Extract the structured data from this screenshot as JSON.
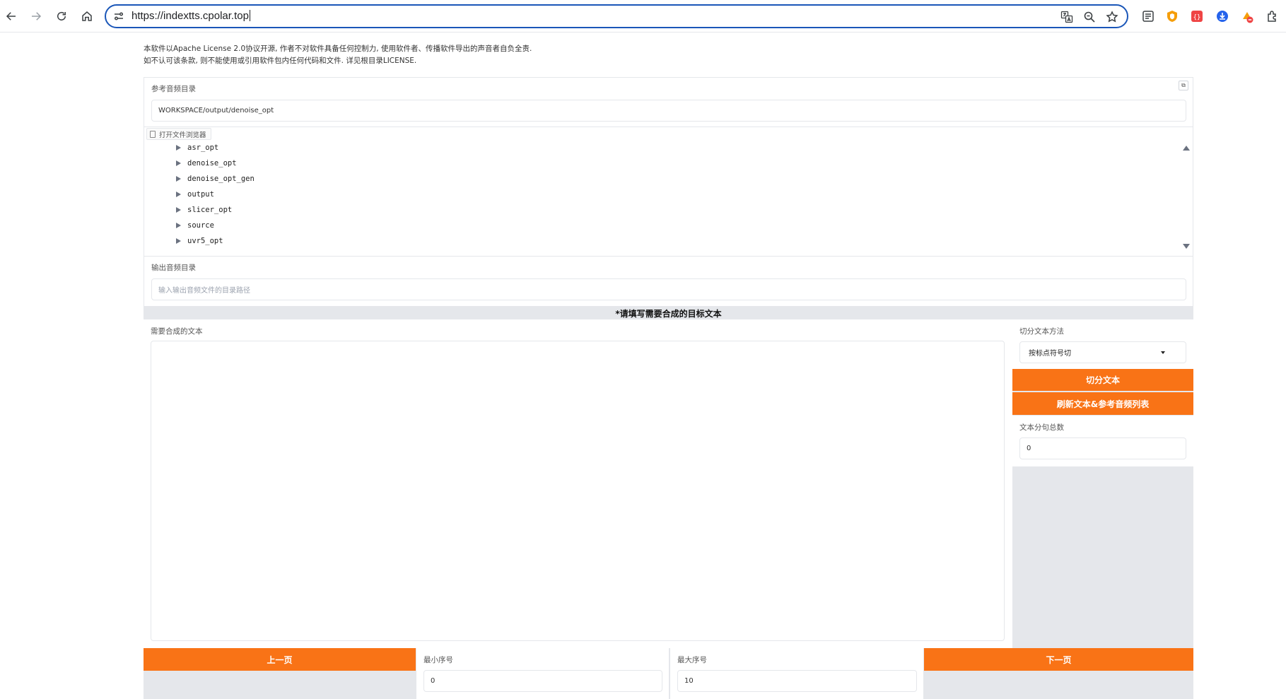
{
  "browser": {
    "url": "https://indextts.cpolar.top",
    "nav": [
      "back",
      "forward",
      "reload",
      "home"
    ],
    "omnibox_icons": [
      "translate-icon",
      "zoom-icon",
      "bookmark-star-icon"
    ],
    "extensions": [
      "reading-list-icon",
      "brave-shield-icon",
      "json-extension-icon",
      "download-extension-icon",
      "blocked-extension-icon",
      "extensions-puzzle-icon"
    ]
  },
  "license": {
    "line1": "本软件以Apache License 2.0协议开源, 作者不对软件具备任何控制力, 使用软件者、传播软件导出的声音者自负全责.",
    "line2": "如不认可该条款, 则不能使用或引用软件包内任何代码和文件. 详见根目录LICENSE."
  },
  "ref_audio": {
    "label": "参考音频目录",
    "value": "WORKSPACE/output/denoise_opt"
  },
  "file_browser": {
    "label": "打开文件浏览器",
    "items": [
      "asr_opt",
      "denoise_opt",
      "denoise_opt_gen",
      "output",
      "slicer_opt",
      "source",
      "uvr5_opt"
    ]
  },
  "output_audio": {
    "label": "输出音频目录",
    "placeholder": "输入输出音频文件的目录路径"
  },
  "section_title": "*请填写需要合成的目标文本",
  "synth_text": {
    "label": "需要合成的文本",
    "value": ""
  },
  "split": {
    "method_label": "切分文本方法",
    "method_value": "按标点符号切",
    "split_button": "切分文本",
    "refresh_button": "刷新文本&参考音频列表",
    "count_label": "文本分句总数",
    "count_value": "0"
  },
  "pager": {
    "prev_button": "上一页",
    "next_button": "下一页",
    "min_label": "最小序号",
    "min_value": "0",
    "max_label": "最大序号",
    "max_value": "10"
  },
  "colors": {
    "accent": "#f97316",
    "focus": "#1a56b8",
    "panel_gray": "#e5e7eb"
  }
}
